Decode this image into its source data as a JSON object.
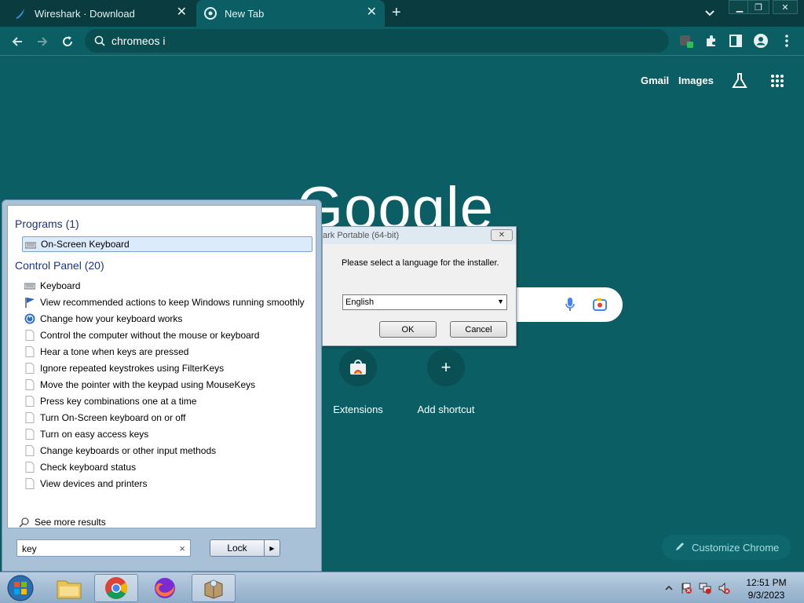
{
  "browser": {
    "tabs": [
      {
        "title": "Wireshark · Download",
        "icon": "wireshark-fin-icon"
      },
      {
        "title": "New Tab",
        "icon": "chrome-icon"
      }
    ],
    "omnibox_text": "chromeos i",
    "theme_color": "#0b5e63"
  },
  "ntp": {
    "links": {
      "gmail": "Gmail",
      "images": "Images"
    },
    "logo_text": "Google",
    "shortcuts": [
      {
        "label": "Extensions",
        "icon": "chrome-web-store-icon"
      },
      {
        "label": "Add shortcut",
        "icon": "plus-icon"
      }
    ],
    "customize_label": "Customize Chrome"
  },
  "installer": {
    "title": "ark Portable (64-bit)",
    "message": "Please select a language for the installer.",
    "language": "English",
    "ok": "OK",
    "cancel": "Cancel",
    "close": "✕"
  },
  "startmenu": {
    "programs_heading": "Programs (1)",
    "programs": [
      {
        "label": "On-Screen Keyboard",
        "icon": "keyboard-icon"
      }
    ],
    "control_heading": "Control Panel (20)",
    "control_items": [
      {
        "label": "Keyboard",
        "icon": "keyboard-icon"
      },
      {
        "label": "View recommended actions to keep Windows running smoothly",
        "icon": "flag-icon"
      },
      {
        "label": "Change how your keyboard works",
        "icon": "ease-of-access-icon"
      },
      {
        "label": "Control the computer without the mouse or keyboard",
        "icon": "page-icon"
      },
      {
        "label": "Hear a tone when keys are pressed",
        "icon": "page-icon"
      },
      {
        "label": "Ignore repeated keystrokes using FilterKeys",
        "icon": "page-icon"
      },
      {
        "label": "Move the pointer with the keypad using MouseKeys",
        "icon": "page-icon"
      },
      {
        "label": "Press key combinations one at a time",
        "icon": "page-icon"
      },
      {
        "label": "Turn On-Screen keyboard on or off",
        "icon": "page-icon"
      },
      {
        "label": "Turn on easy access keys",
        "icon": "page-icon"
      },
      {
        "label": "Change keyboards or other input methods",
        "icon": "page-icon"
      },
      {
        "label": "Check keyboard status",
        "icon": "page-icon"
      },
      {
        "label": "View devices and printers",
        "icon": "page-icon"
      }
    ],
    "see_more": "See more results",
    "search_value": "key",
    "lock_label": "Lock"
  },
  "taskbar": {
    "time": "12:51 PM",
    "date": "9/3/2023"
  }
}
